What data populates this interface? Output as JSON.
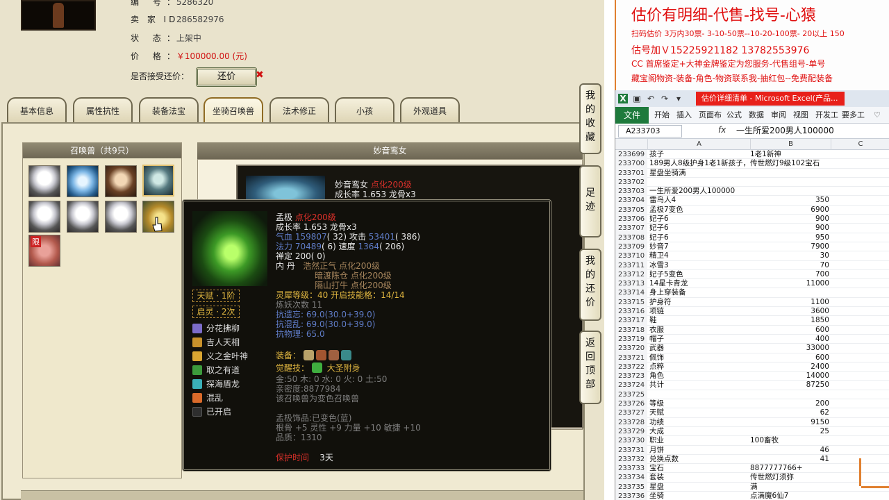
{
  "seller_info": {
    "number_label": "编 号：",
    "number_value": "5286320",
    "seller_label": "卖 家 ID：",
    "seller_value": "286582976",
    "status_label": "状 态：",
    "status_value": "上架中",
    "price_label": "价 格：",
    "price_value": "￥100000.00 (元)",
    "offer_label": "是否接受还价：",
    "bargain_button": "还价",
    "bargain_x": "✖"
  },
  "tabs": [
    "基本信息",
    "属性抗性",
    "装备法宝",
    "坐骑召唤兽",
    "法术修正",
    "小孩",
    "外观道具"
  ],
  "active_tab": "坐骑召唤兽",
  "pet_list": {
    "title": "召唤兽（共9只）",
    "limit_tag": "限"
  },
  "pet_detail": {
    "header": "妙音鸾女",
    "name": "妙音鸾女",
    "tier": "点化200级",
    "growth": "成长率 1.653 龙骨x3"
  },
  "tooltip": {
    "name": "孟极",
    "tier": "点化200级",
    "growth": "成长率 1.653 龙骨x3",
    "hp_label": "气血",
    "hp": "159807",
    "hp_extra": "( 32)",
    "atk_label": "攻击",
    "atk": "53401",
    "atk_extra": "( 386)",
    "mp_label": "法力",
    "mp": "70489",
    "mp_extra": "( 6)",
    "spd_label": "速度",
    "spd": "1364",
    "spd_extra": "( 206)",
    "def_label": "禅定",
    "def": "200",
    "def_extra": "( 0)",
    "core_label": "内 丹",
    "cores": [
      "浩然正气 点化200级",
      "暗渡陈仓 点化200级",
      "隔山打牛 点化200级"
    ],
    "talent": "天赋 · 1阶",
    "awaken": "启灵 · 2次",
    "spirit": "灵犀等级：40 开启技能格：14/14",
    "refine": "炼妖次数 11",
    "res1": "抗遗忘: 69.0(30.0+39.0)",
    "res2": "抗混乱: 69.0(30.0+39.0)",
    "res3": "抗物理: 65.0",
    "equip_label": "装备：",
    "awake_skill_label": "觉醒技：",
    "awake_skill": "大圣附身",
    "elements": "金:50 木: 0 水: 0 火: 0 土:50",
    "intimacy": "亲密度:8877984",
    "variant_note": "该召唤兽为变色召唤兽",
    "ornament": "孟极饰品:已变色(蓝)",
    "bone_line": "根骨 +5 灵性 +9 力量 +10 敏捷 +10",
    "quality": "品质：1310",
    "protect_label": "保护时间",
    "protect_value": "3天",
    "skills": [
      "分花拂柳",
      "吉人天相",
      "义之金叶神",
      "取之有道",
      "探海盾龙",
      "混乱",
      "已开启"
    ]
  },
  "side_buttons": [
    [
      "我",
      "的",
      "收",
      "藏"
    ],
    [
      "足",
      "迹"
    ],
    [
      "我",
      "的",
      "还",
      "价"
    ],
    [
      "返",
      "回",
      "顶",
      "部"
    ]
  ],
  "banner": {
    "line1": "估价有明细-代售-找号-心猿",
    "line2": "扫码估价 3万内30票- 3-10-50票--10-20-100票- 20以上 150",
    "line3": "估号加Ｖ15225921182 13782553976",
    "line4": "CC 首席鉴定+大神金牌鉴定为您服务-代售组号-单号",
    "line5": "藏宝阁物资-装备-角色-物资联系我-抽红包--免费配装备"
  },
  "excel": {
    "title": "估价详细清单 - Microsoft Excel(产品...",
    "ribbon_tabs": [
      "开始",
      "插入",
      "页面布",
      "公式",
      "数据",
      "审阅",
      "视图",
      "开发工",
      "要多工"
    ],
    "file_tab": "文件",
    "name_box": "A233703",
    "fx": "fx",
    "formula": "一生所爱200男人100000",
    "columns": [
      "A",
      "B",
      "C"
    ],
    "rows": [
      [
        "233699",
        "孩子",
        "1老1新神"
      ],
      [
        "233700",
        "189男人8级护身1老1新孩子，",
        "传世燃灯9级102宝石"
      ],
      [
        "233701",
        "星盘坐骑满",
        ""
      ],
      [
        "233702",
        "",
        ""
      ],
      [
        "233703",
        "一生所爱200男人100000",
        ""
      ],
      [
        "233704",
        "雷鸟人4",
        "350"
      ],
      [
        "233705",
        "孟极7变色",
        "6900"
      ],
      [
        "233706",
        "妃子6",
        "900"
      ],
      [
        "233707",
        "妃子6",
        "900"
      ],
      [
        "233708",
        "妃子6",
        "950"
      ],
      [
        "233709",
        "妙音7",
        "7900"
      ],
      [
        "233710",
        "精卫4",
        "30"
      ],
      [
        "233711",
        "冰雪3",
        "70"
      ],
      [
        "233712",
        "妃子5变色",
        "700"
      ],
      [
        "233713",
        "14星卡青龙",
        "11000"
      ],
      [
        "233714",
        "身上穿装备",
        ""
      ],
      [
        "233715",
        "护身符",
        "1100"
      ],
      [
        "233716",
        "项链",
        "3600"
      ],
      [
        "233717",
        "鞋",
        "1850"
      ],
      [
        "233718",
        "衣服",
        "600"
      ],
      [
        "233719",
        "帽子",
        "400"
      ],
      [
        "233720",
        "武器",
        "33000"
      ],
      [
        "233721",
        "佩饰",
        "600"
      ],
      [
        "233722",
        "点粹",
        "2400"
      ],
      [
        "233723",
        "角色",
        "14000"
      ],
      [
        "233724",
        "共计",
        "87250"
      ],
      [
        "233725",
        "",
        ""
      ],
      [
        "233726",
        "等级",
        "200"
      ],
      [
        "233727",
        "天赋",
        "62"
      ],
      [
        "233728",
        "功绩",
        "9150"
      ],
      [
        "233729",
        "大成",
        "25"
      ],
      [
        "233730",
        "职业",
        "100畜牧"
      ],
      [
        "233731",
        "月饼",
        "46"
      ],
      [
        "233732",
        "兑换点数",
        "41"
      ],
      [
        "233733",
        "宝石",
        "8877777766+"
      ],
      [
        "233734",
        "套装",
        "传世燃灯须弥"
      ],
      [
        "233735",
        "星盘",
        "满"
      ],
      [
        "233736",
        "坐骑",
        "点满魔6仙7"
      ]
    ]
  },
  "colors": {
    "accent_red": "#d01010",
    "excel_green": "#1e7a3c",
    "banner_red": "#e01010"
  }
}
